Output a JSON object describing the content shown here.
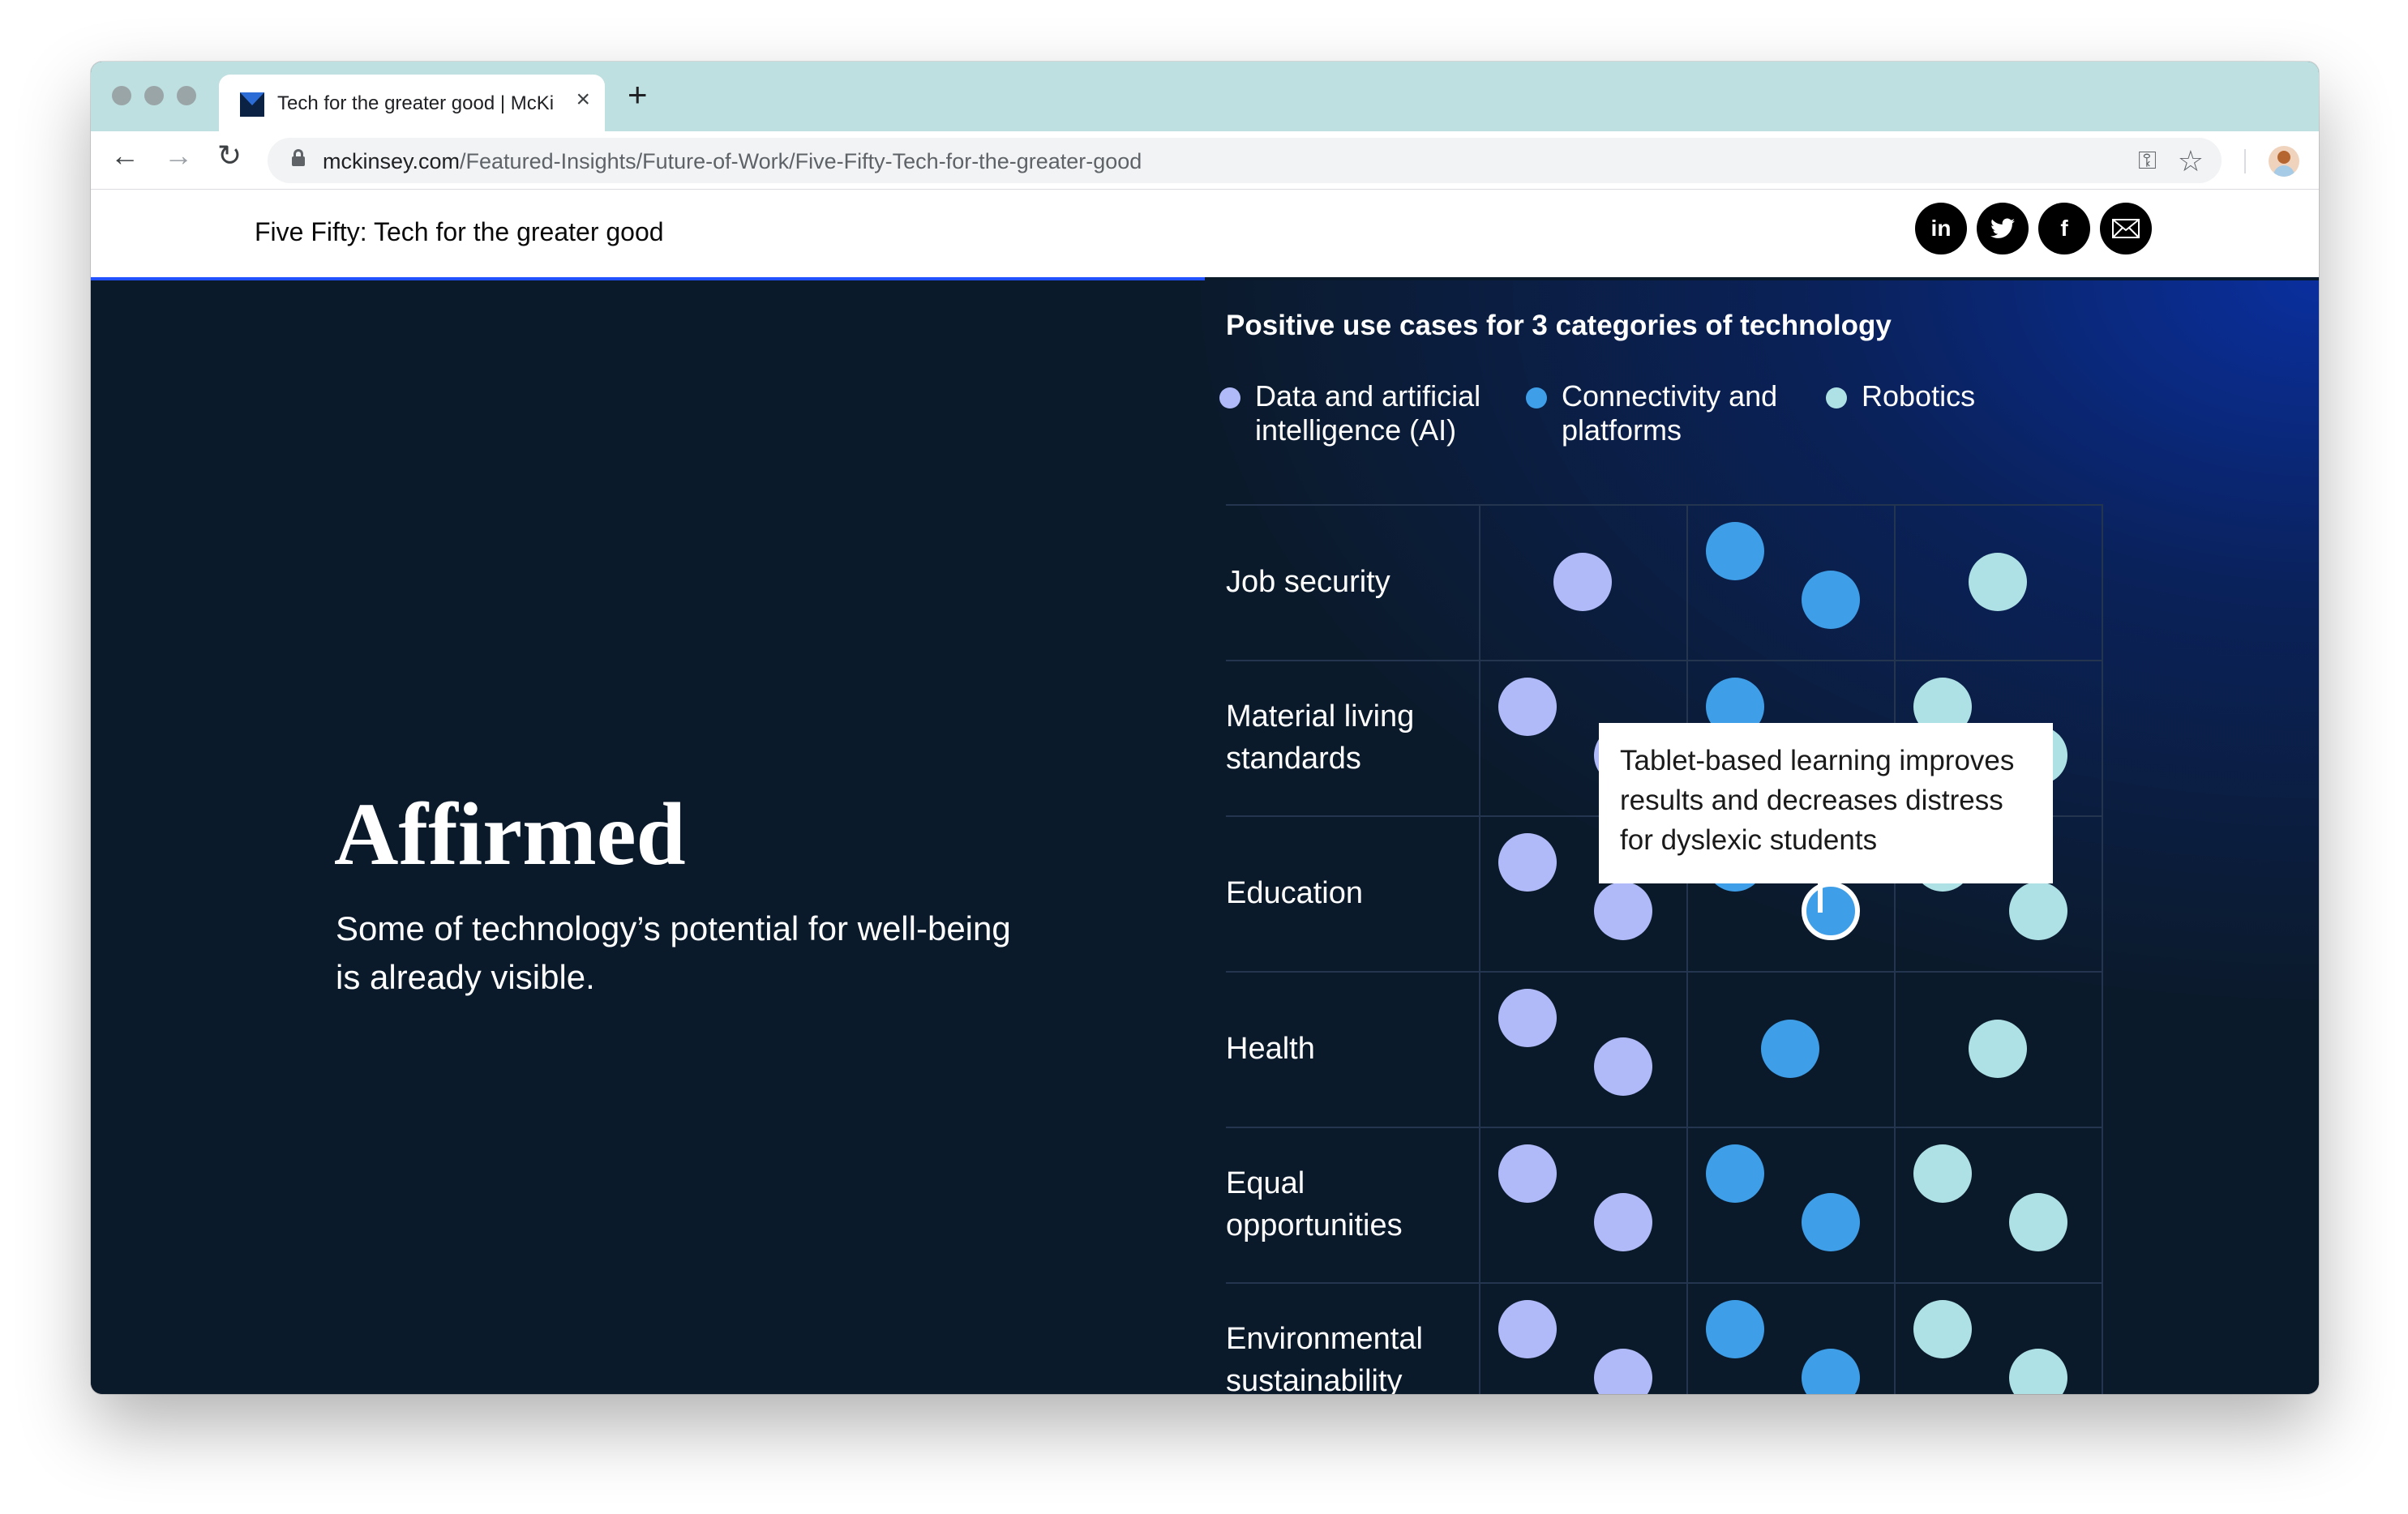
{
  "browser": {
    "tab_title": "Tech for the greater good | McKinsey",
    "tab_close": "×",
    "new_tab": "+",
    "url_host": "mckinsey.com",
    "url_path": "/Featured-Insights/Future-of-Work/Five-Fifty-Tech-for-the-greater-good",
    "icons": {
      "back": "←",
      "forward": "→",
      "reload": "↻",
      "key": "⚿",
      "star": "☆"
    }
  },
  "header": {
    "title": "Five Fifty: Tech for the greater good",
    "share": {
      "linkedin": "in",
      "twitter": "🐦",
      "facebook": "f"
    }
  },
  "reading_progress": 0.5,
  "hero": {
    "headline": "Affirmed",
    "subhead": "Some of technology’s potential for well-being is already visible."
  },
  "colors": {
    "background": "#0b1a2b",
    "ai": "#b1baf8",
    "connectivity": "#3e9ee8",
    "robotics": "#aee1e5",
    "progress": "#2251ff"
  },
  "chart_data": {
    "type": "table",
    "title": "Positive use cases for 3 categories of technology",
    "categories": [
      "Data and artificial intelligence (AI)",
      "Connectivity and platforms",
      "Robotics"
    ],
    "legend": [
      {
        "key": "ai",
        "label": "Data and artificial intelligence (AI)"
      },
      {
        "key": "conn",
        "label": "Connectivity and platforms"
      },
      {
        "key": "rob",
        "label": "Robotics"
      }
    ],
    "rows": [
      {
        "label": "Job security",
        "values": [
          1,
          2,
          1
        ]
      },
      {
        "label": "Material living standards",
        "values": [
          2,
          2,
          2
        ]
      },
      {
        "label": "Education",
        "values": [
          2,
          2,
          2
        ]
      },
      {
        "label": "Health",
        "values": [
          2,
          1,
          1
        ]
      },
      {
        "label": "Equal opportunities",
        "values": [
          2,
          2,
          2
        ]
      },
      {
        "label": "Environmental sustainability",
        "values": [
          2,
          2,
          2
        ]
      }
    ],
    "tooltip": {
      "row": "Education",
      "category": "Connectivity and platforms",
      "text": "Tablet-based learning improves results and decreases distress for dyslexic students"
    }
  }
}
